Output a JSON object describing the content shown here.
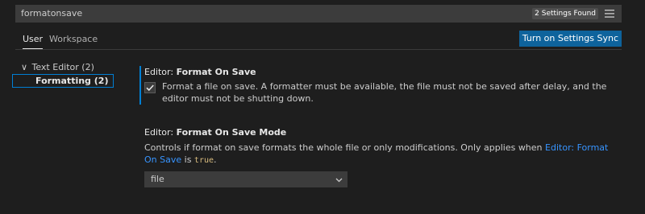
{
  "search": {
    "value": "formatonsave",
    "count_badge": "2 Settings Found"
  },
  "tabs": [
    {
      "label": "User",
      "active": true
    },
    {
      "label": "Workspace",
      "active": false
    }
  ],
  "sync_button_label": "Turn on Settings Sync",
  "toc": {
    "group": {
      "chevron": "∨",
      "label": "Text Editor (2)"
    },
    "sub": {
      "label": "Formatting (2)"
    }
  },
  "settings": [
    {
      "category": "Editor: ",
      "name": "Format On Save",
      "checked": true,
      "description": "Format a file on save. A formatter must be available, the file must not be saved after delay, and the editor must not be shutting down."
    },
    {
      "category": "Editor: ",
      "name": "Format On Save Mode",
      "description_before": "Controls if format on save formats the whole file or only modifications. Only applies when ",
      "description_link": "Editor: Format On Save",
      "description_mid": " is ",
      "description_code": "true",
      "description_after": ".",
      "select_value": "file"
    }
  ],
  "icons": {
    "filter": "filter-icon",
    "checkbox_check": "check-icon",
    "select_chevron": "chevron-down-icon"
  },
  "colors": {
    "background": "#1e1e1e",
    "accent": "#007fd4",
    "button": "#0e639c",
    "link": "#3794ff"
  }
}
